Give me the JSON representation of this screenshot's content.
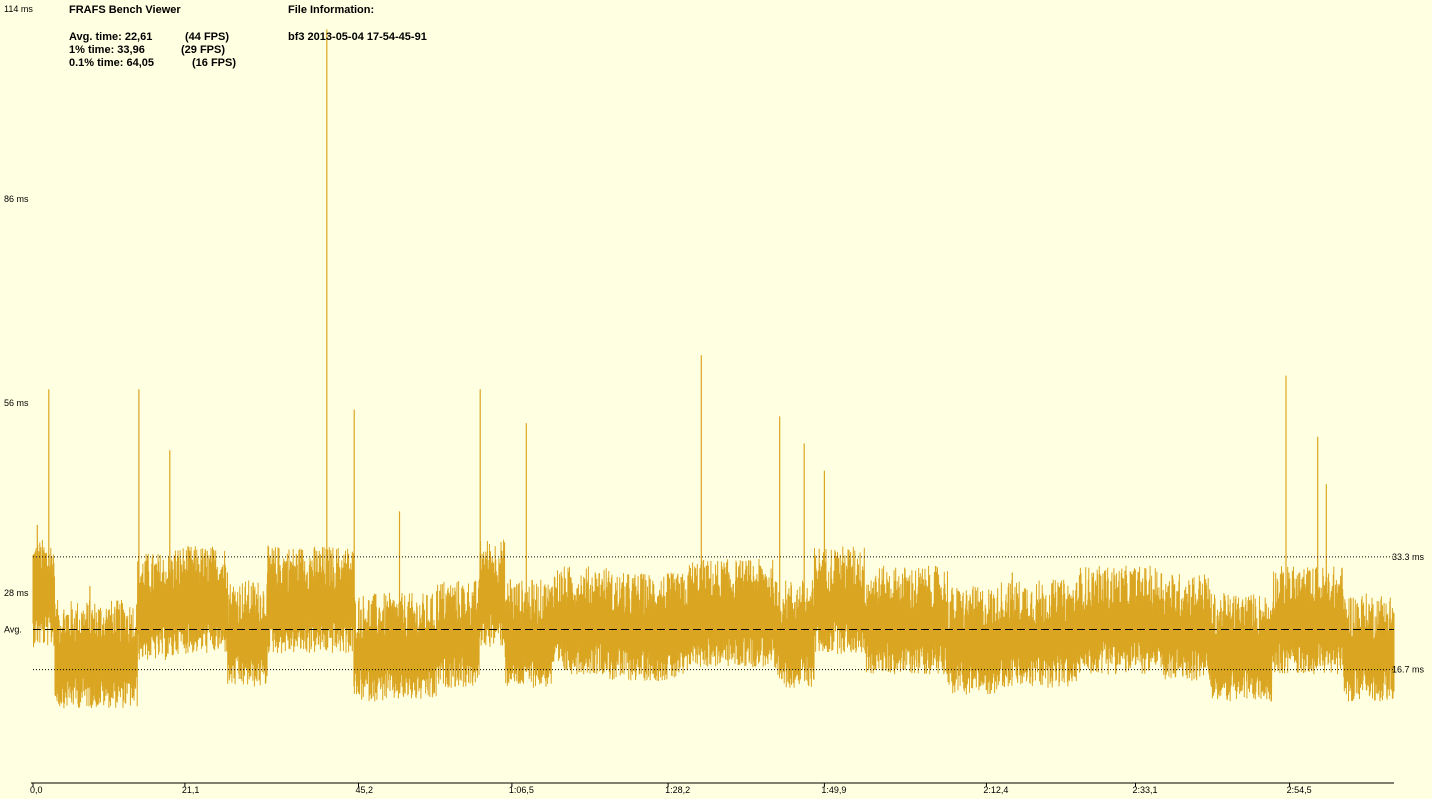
{
  "header": {
    "app_title": "FRAFS Bench Viewer",
    "stats": [
      {
        "label": "Avg. time: 22,61",
        "fps": "(44 FPS)"
      },
      {
        "label": "1% time: 33,96",
        "fps": "(29 FPS)"
      },
      {
        "label": "0.1% time: 64,05",
        "fps": "(16 FPS)"
      }
    ],
    "file_info_title": "File Information:",
    "file_name": "bf3 2013-05-04 17-54-45-91"
  },
  "colors": {
    "background": "#ffffe1",
    "series": "#daa520",
    "grid": "#000000"
  },
  "chart_data": {
    "type": "line",
    "title": "",
    "xlabel": "",
    "ylabel": "",
    "y_unit": "ms",
    "x_unit": "s",
    "xlim": [
      0,
      189
    ],
    "ylim": [
      0,
      114
    ],
    "y_ticks": [
      {
        "value": 114,
        "label": "114 ms"
      },
      {
        "value": 86,
        "label": "86 ms"
      },
      {
        "value": 56,
        "label": "56 ms"
      },
      {
        "value": 28,
        "label": "28 ms"
      }
    ],
    "x_ticks": [
      {
        "value": 0,
        "label": "0,0"
      },
      {
        "value": 21.1,
        "label": "21,1"
      },
      {
        "value": 45.2,
        "label": "45,2"
      },
      {
        "value": 66.5,
        "label": "1:06,5"
      },
      {
        "value": 88.2,
        "label": "1:28,2"
      },
      {
        "value": 109.9,
        "label": "1:49,9"
      },
      {
        "value": 132.4,
        "label": "2:12,4"
      },
      {
        "value": 153.1,
        "label": "2:33,1"
      },
      {
        "value": 174.5,
        "label": "2:54,5"
      }
    ],
    "reference_lines": [
      {
        "value": 33.3,
        "label": "33.3 ms",
        "label_side": "right",
        "style": "dotted"
      },
      {
        "value": 22.61,
        "label": "Avg.",
        "label_side": "left",
        "style": "dashed"
      },
      {
        "value": 16.7,
        "label": "16.7 ms",
        "label_side": "right",
        "style": "dotted"
      }
    ],
    "series": [
      {
        "color": "#daa520",
        "segments": [
          {
            "t0": 0,
            "t1": 3,
            "mean": 27
          },
          {
            "t0": 3,
            "t1": 14.5,
            "mean": 18
          },
          {
            "t0": 14.5,
            "t1": 19.5,
            "mean": 25
          },
          {
            "t0": 19.5,
            "t1": 27,
            "mean": 26
          },
          {
            "t0": 27,
            "t1": 32.5,
            "mean": 21
          },
          {
            "t0": 32.5,
            "t1": 44.5,
            "mean": 26
          },
          {
            "t0": 44.5,
            "t1": 56,
            "mean": 19
          },
          {
            "t0": 56,
            "t1": 62,
            "mean": 21
          },
          {
            "t0": 62,
            "t1": 65.5,
            "mean": 27
          },
          {
            "t0": 65.5,
            "t1": 72,
            "mean": 21
          },
          {
            "t0": 72,
            "t1": 80,
            "mean": 23
          },
          {
            "t0": 80,
            "t1": 91,
            "mean": 22
          },
          {
            "t0": 91,
            "t1": 103,
            "mean": 24
          },
          {
            "t0": 103,
            "t1": 108.5,
            "mean": 21
          },
          {
            "t0": 108.5,
            "t1": 115.5,
            "mean": 26
          },
          {
            "t0": 115.5,
            "t1": 127,
            "mean": 23
          },
          {
            "t0": 127,
            "t1": 134,
            "mean": 20
          },
          {
            "t0": 134,
            "t1": 145,
            "mean": 21
          },
          {
            "t0": 145,
            "t1": 157,
            "mean": 23
          },
          {
            "t0": 157,
            "t1": 163.5,
            "mean": 22
          },
          {
            "t0": 163.5,
            "t1": 172,
            "mean": 19
          },
          {
            "t0": 172,
            "t1": 182,
            "mean": 23
          },
          {
            "t0": 182,
            "t1": 189,
            "mean": 19
          }
        ],
        "spikes": [
          {
            "t": 0.3,
            "value": 34
          },
          {
            "t": 0.6,
            "value": 38
          },
          {
            "t": 2.2,
            "value": 58
          },
          {
            "t": 7.9,
            "value": 29
          },
          {
            "t": 14.7,
            "value": 58
          },
          {
            "t": 19.0,
            "value": 49
          },
          {
            "t": 27.0,
            "value": 31
          },
          {
            "t": 40.8,
            "value": 111
          },
          {
            "t": 44.6,
            "value": 55
          },
          {
            "t": 50.9,
            "value": 40
          },
          {
            "t": 62.1,
            "value": 58
          },
          {
            "t": 66.3,
            "value": 30
          },
          {
            "t": 68.5,
            "value": 53
          },
          {
            "t": 71.0,
            "value": 29
          },
          {
            "t": 92.8,
            "value": 63
          },
          {
            "t": 103.7,
            "value": 54
          },
          {
            "t": 107.1,
            "value": 50
          },
          {
            "t": 109.9,
            "value": 46
          },
          {
            "t": 136.0,
            "value": 31
          },
          {
            "t": 174.0,
            "value": 60
          },
          {
            "t": 174.4,
            "value": 31
          },
          {
            "t": 178.4,
            "value": 51
          },
          {
            "t": 179.6,
            "value": 44
          }
        ]
      }
    ]
  }
}
